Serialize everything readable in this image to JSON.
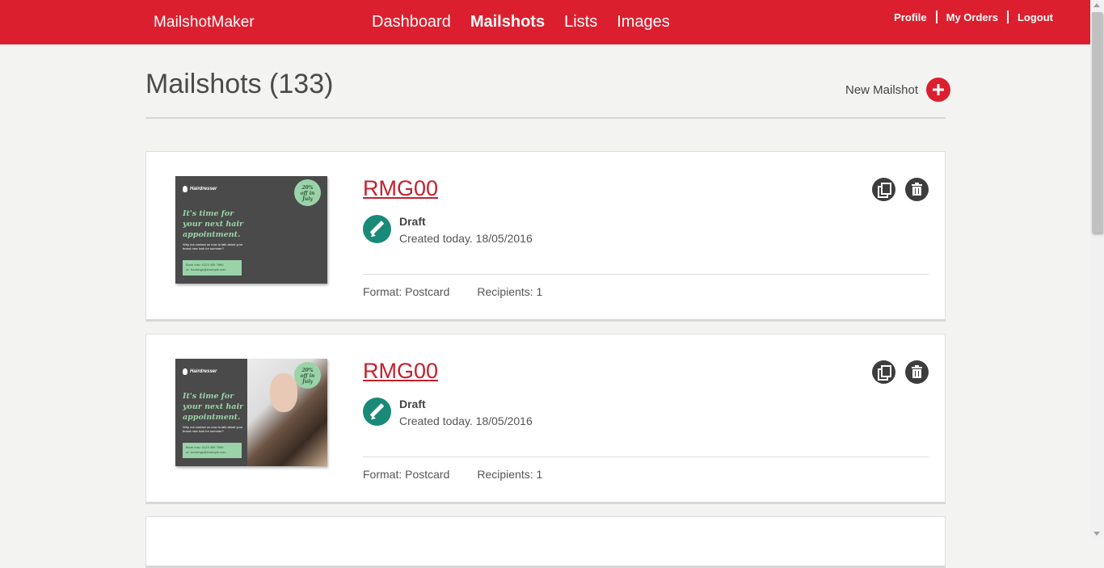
{
  "header": {
    "brand": "MailshotMaker",
    "nav": [
      "Dashboard",
      "Mailshots",
      "Lists",
      "Images"
    ],
    "active_nav": "Mailshots",
    "user_links": [
      "Profile",
      "My Orders",
      "Logout"
    ],
    "bar_color": "#dc1f2e"
  },
  "page": {
    "title": "Mailshots (133)",
    "new_label": "New Mailshot"
  },
  "mailshots": [
    {
      "name": "RMG00",
      "status": "Draft",
      "created": "Created today. 18/05/2016",
      "format": "Format: Postcard",
      "recipients": "Recipients: 1",
      "thumb": {
        "brand": "Hairdresser",
        "badge_line1": "20%",
        "badge_line2": "off in",
        "badge_line3": "July",
        "headline": "It's time for your next hair appointment.",
        "body": "Why not contact us now to talk about your brand new look for summer?",
        "cta_line1": "Book now: 0123 456 7890",
        "cta_line2": "or: bookings@example.com"
      }
    },
    {
      "name": "RMG00",
      "status": "Draft",
      "created": "Created today. 18/05/2016",
      "format": "Format: Postcard",
      "recipients": "Recipients: 1",
      "thumb": {
        "brand": "Hairdresser",
        "badge_line1": "20%",
        "badge_line2": "off in",
        "badge_line3": "July",
        "headline": "It's time for your next hair appointment.",
        "body": "Why not contact us now to talk about your brand new look for summer?",
        "cta_line1": "Book now: 0123 456 7890",
        "cta_line2": "or: bookings@example.com"
      }
    }
  ],
  "icons": {
    "status": "pencil-icon",
    "copy": "copy-icon",
    "delete": "trash-icon",
    "new": "plus-icon"
  }
}
